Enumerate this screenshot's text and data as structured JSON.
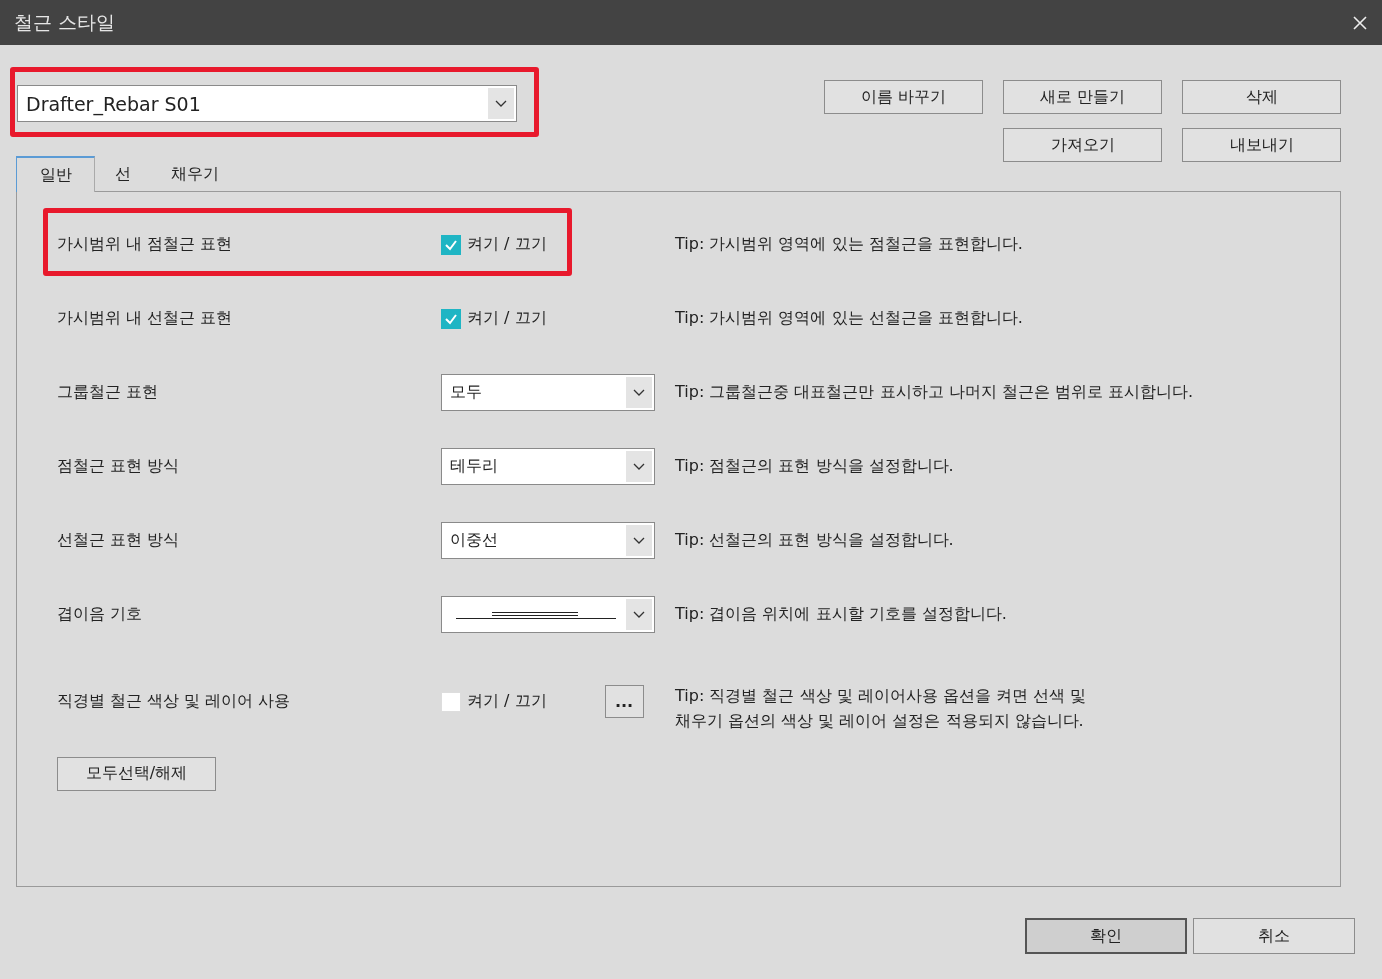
{
  "window": {
    "title": "철근 스타일"
  },
  "style_selector": {
    "value": "Drafter_Rebar S01",
    "highlighted": true
  },
  "toolbar_buttons": [
    [
      "이름 바꾸기",
      "새로 만들기",
      "삭제"
    ],
    [
      "가져오기",
      "내보내기"
    ]
  ],
  "tabs": [
    {
      "label": "일반",
      "selected": true
    },
    {
      "label": "선",
      "selected": false
    },
    {
      "label": "채우기",
      "selected": false
    }
  ],
  "rows": [
    {
      "kind": "checkbox",
      "label": "가시범위 내 점철근 표현",
      "checked": true,
      "option_label": "켜기 / 끄기",
      "tip": "Tip: 가시범위 영역에 있는 점철근을 표현합니다.",
      "highlighted": true
    },
    {
      "kind": "checkbox",
      "label": "가시범위 내 선철근 표현",
      "checked": true,
      "option_label": "켜기 / 끄기",
      "tip": "Tip: 가시범위 영역에 있는 선철근을 표현합니다.",
      "highlighted": false
    },
    {
      "kind": "select",
      "label": "그룹철근 표현",
      "value": "모두",
      "tip": "Tip: 그룹철근중 대표철근만 표시하고 나머지 철근은 범위로 표시합니다.",
      "highlighted": false
    },
    {
      "kind": "select",
      "label": "점철근 표현 방식",
      "value": "테두리",
      "tip": "Tip: 점철근의 표현 방식을 설정합니다.",
      "highlighted": false
    },
    {
      "kind": "select",
      "label": "선철근 표현 방식",
      "value": "이중선",
      "tip": "Tip: 선철근의 표현 방식을 설정합니다.",
      "highlighted": false
    },
    {
      "kind": "line-select",
      "label": "겹이음 기호",
      "tip": "Tip: 겹이음 위치에 표시할 기호를 설정합니다.",
      "highlighted": false
    },
    {
      "kind": "checkbox-button",
      "label": "직경별 철근 색상 및 레이어 사용",
      "checked": false,
      "option_label": "켜기 / 끄기",
      "button_label": "...",
      "tip": "Tip: 직경별 철근 색상 및 레이어사용 옵션을 켜면 선색 및\n채우기 옵션의 색상 및 레이어 설정은 적용되지 않습니다.",
      "highlighted": false
    }
  ],
  "select_all_button": "모두선택/해제",
  "dialog_buttons": [
    {
      "label": "확인",
      "default": true
    },
    {
      "label": "취소",
      "default": false
    }
  ]
}
